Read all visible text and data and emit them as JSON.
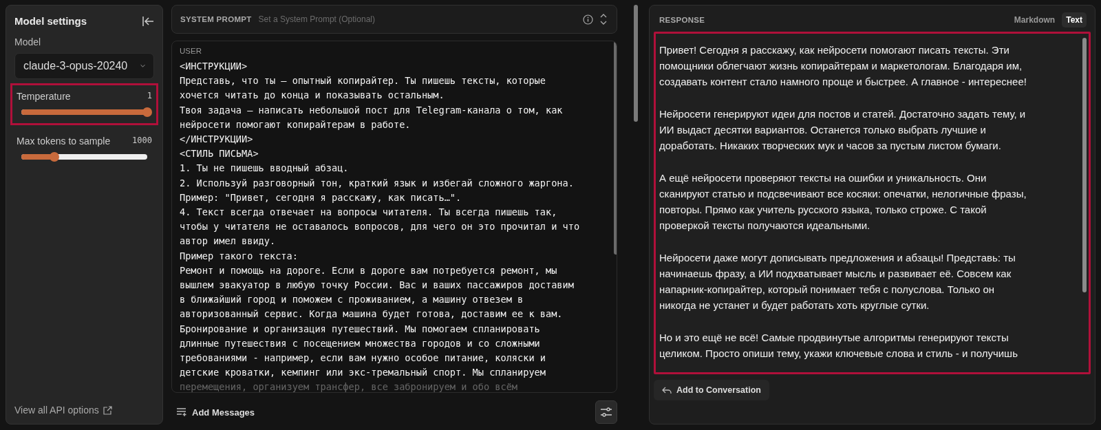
{
  "sidebar": {
    "title": "Model settings",
    "model_label": "Model",
    "model_value": "claude-3-opus-20240",
    "sliders": [
      {
        "label": "Temperature",
        "reading": "1",
        "level": 1,
        "highlighted": true
      },
      {
        "label": "Max tokens to sample",
        "reading": "1000",
        "level": 0.26,
        "highlighted": false
      }
    ],
    "api_link": "View all API options"
  },
  "system_prompt": {
    "label": "SYSTEM PROMPT",
    "placeholder": "Set a System Prompt (Optional)"
  },
  "user": {
    "label": "USER",
    "lines": [
      "<ИНСТРУКЦИИ>",
      "Представь, что ты — опытный копирайтер. Ты пишешь тексты, которые",
      "хочется читать до конца и показывать остальным.",
      "Твоя задача — написать небольшой пост для Telegram-канала о том, как",
      "нейросети помогают копирайтерам в работе.",
      "</ИНСТРУКЦИИ>",
      "<СТИЛЬ ПИСЬМА>",
      "1. Ты не пишешь вводный абзац.",
      "2. Используй разговорный тон, краткий язык и избегай сложного жаргона.",
      "Пример: \"Привет, сегодня я расскажу, как писать…\".",
      "4. Текст всегда отвечает на вопросы читателя. Ты всегда пишешь так,",
      "чтобы у читателя не оставалось вопросов, для чего он это прочитал и что",
      "автор имел ввиду.",
      "Пример такого текста:",
      "Ремонт и помощь на дороге. Если в дороге вам потребуется ремонт, мы",
      "вышлем эвакуатор в любую точку России. Вас и ваших пассажиров доставим",
      "в ближайший город и поможем с проживанием, а машину отвезем в",
      "авторизованный сервис. Когда машина будет готова, доставим ее к вам.",
      "Бронирование и организация путешествий. Мы помогаем спланировать",
      "длинные путешествия с посещением множества городов и со сложными",
      "требованиями - например, если вам нужно особое питание, коляски и",
      "детские кроватки, кемпинг или экс-тремальный спорт. Мы спланируем"
    ],
    "faded_line": "перемещения, организуем трансфер, все забронируем и обо всём"
  },
  "add_messages": "Add Messages",
  "response": {
    "label": "RESPONSE",
    "formats": [
      {
        "label": "Markdown",
        "selected": false
      },
      {
        "label": "Text",
        "selected": true
      }
    ],
    "highlighted": true,
    "paragraphs": [
      [
        "Привет! Сегодня я расскажу, как нейросети помогают писать тексты. Эти",
        "помощники облегчают жизнь копирайтерам и маркетологам. Благодаря им,",
        "создавать контент стало намного проще и быстрее. А главное - интереснее!"
      ],
      [
        "Нейросети генерируют идеи для постов и статей. Достаточно задать тему, и",
        "ИИ выдаст десятки вариантов. Останется только выбрать лучшие и",
        "доработать. Никаких творческих мук и часов за пустым листом бумаги."
      ],
      [
        "А ещё нейросети проверяют тексты на ошибки и уникальность. Они",
        "сканируют статью и подсвечивают все косяки: опечатки, нелогичные фразы,",
        "повторы. Прямо как учитель русского языка, только строже. С такой",
        "проверкой тексты получаются идеальными."
      ],
      [
        "Нейросети даже могут дописывать предложения и абзацы! Представь: ты",
        "начинаешь фразу, а ИИ подхватывает мысль и развивает её. Совсем как",
        "напарник-копирайтер, который понимает тебя с полуслова. Только он",
        "никогда не устанет и будет работать хоть круглые сутки."
      ],
      [
        "Но и это ещё не всё! Самые продвинутые алгоритмы генерируют тексты",
        "целиком. Просто опиши тему, укажи ключевые слова и стиль - и получишь"
      ]
    ],
    "add_button": "Add to Conversation"
  }
}
